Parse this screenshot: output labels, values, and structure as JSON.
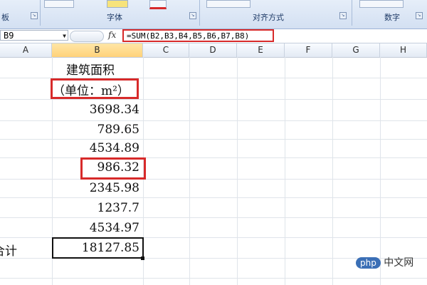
{
  "ribbon": {
    "groups": [
      {
        "label": "板",
        "launcher": "↘"
      },
      {
        "label": "字体",
        "launcher": "↘"
      },
      {
        "label": "对齐方式",
        "launcher": "↘"
      },
      {
        "label": "数字",
        "launcher": "↘"
      }
    ]
  },
  "formula_bar": {
    "name_box": "B9",
    "fx_label": "fx",
    "formula": "=SUM(B2,B3,B4,B5,B6,B7,B8)"
  },
  "columns": [
    "A",
    "B",
    "C",
    "D",
    "E",
    "F",
    "G",
    "H"
  ],
  "active_column": "B",
  "sheet": {
    "header_line1": "建筑面积",
    "header_line2": "（单位：m²）",
    "values": [
      "3698.34",
      "789.65",
      "4534.89",
      "986.32",
      "2345.98",
      "1237.7",
      "4534.97"
    ],
    "total_label": "合计",
    "total_value": "18127.85"
  },
  "watermark": {
    "badge": "php",
    "text": "中文网"
  },
  "colors": {
    "highlight": "#d72a2a",
    "active_header": "#ffd27a"
  }
}
